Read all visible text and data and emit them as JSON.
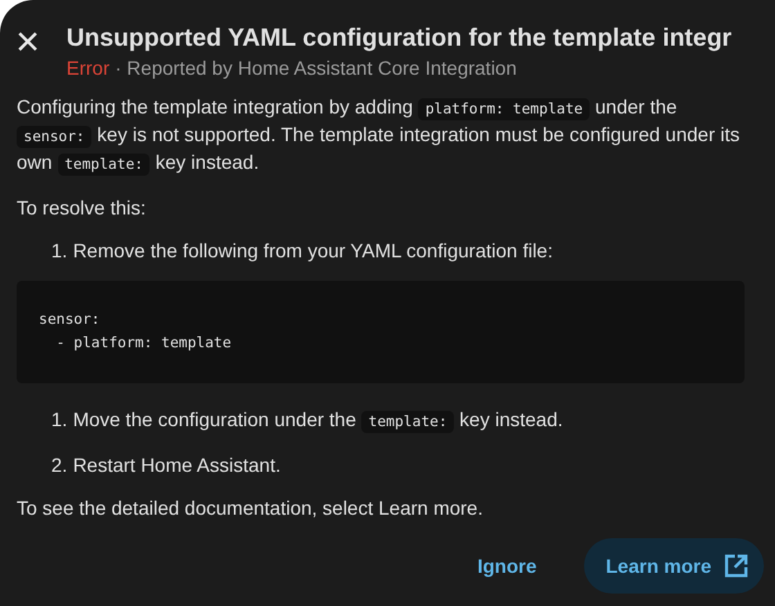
{
  "dialog": {
    "close_icon": "×",
    "title": "Unsupported YAML configuration for the template integr",
    "severity": "Error",
    "reporter": "· Reported by Home Assistant Core Integration"
  },
  "body": [
    {
      "kind": "paragraph",
      "parts": [
        {
          "kind": "text",
          "text": "Configuring the template integration by adding "
        },
        {
          "kind": "code",
          "text": "platform: template"
        },
        {
          "kind": "text",
          "text": " under the "
        },
        {
          "kind": "code",
          "text": "sensor:"
        },
        {
          "kind": "text",
          "text": " key is not supported. The template integration must be configured under its own "
        },
        {
          "kind": "code",
          "text": "template:"
        },
        {
          "kind": "text",
          "text": " key instead."
        }
      ]
    },
    {
      "kind": "paragraph",
      "parts": [
        {
          "kind": "text",
          "text": "To resolve this:"
        }
      ]
    },
    {
      "kind": "list",
      "items": [
        {
          "number": "1.",
          "parts": [
            {
              "kind": "text",
              "text": "Remove the following from your YAML configuration file:"
            }
          ]
        }
      ]
    },
    {
      "kind": "codeblock",
      "lines": [
        "sensor:",
        "  - platform: template"
      ]
    },
    {
      "kind": "list",
      "items": [
        {
          "number": "1.",
          "parts": [
            {
              "kind": "text",
              "text": "Move the configuration under the "
            },
            {
              "kind": "code",
              "text": "template:"
            },
            {
              "kind": "text",
              "text": " key instead."
            }
          ]
        },
        {
          "number": "2.",
          "parts": [
            {
              "kind": "text",
              "text": "Restart Home Assistant."
            }
          ]
        }
      ]
    },
    {
      "kind": "paragraph",
      "parts": [
        {
          "kind": "text",
          "text": "To see the detailed documentation, select Learn more."
        }
      ]
    }
  ],
  "buttons": [
    {
      "label": "Ignore",
      "kind": "text"
    },
    {
      "label": "Learn more",
      "kind": "tonal"
    }
  ]
}
